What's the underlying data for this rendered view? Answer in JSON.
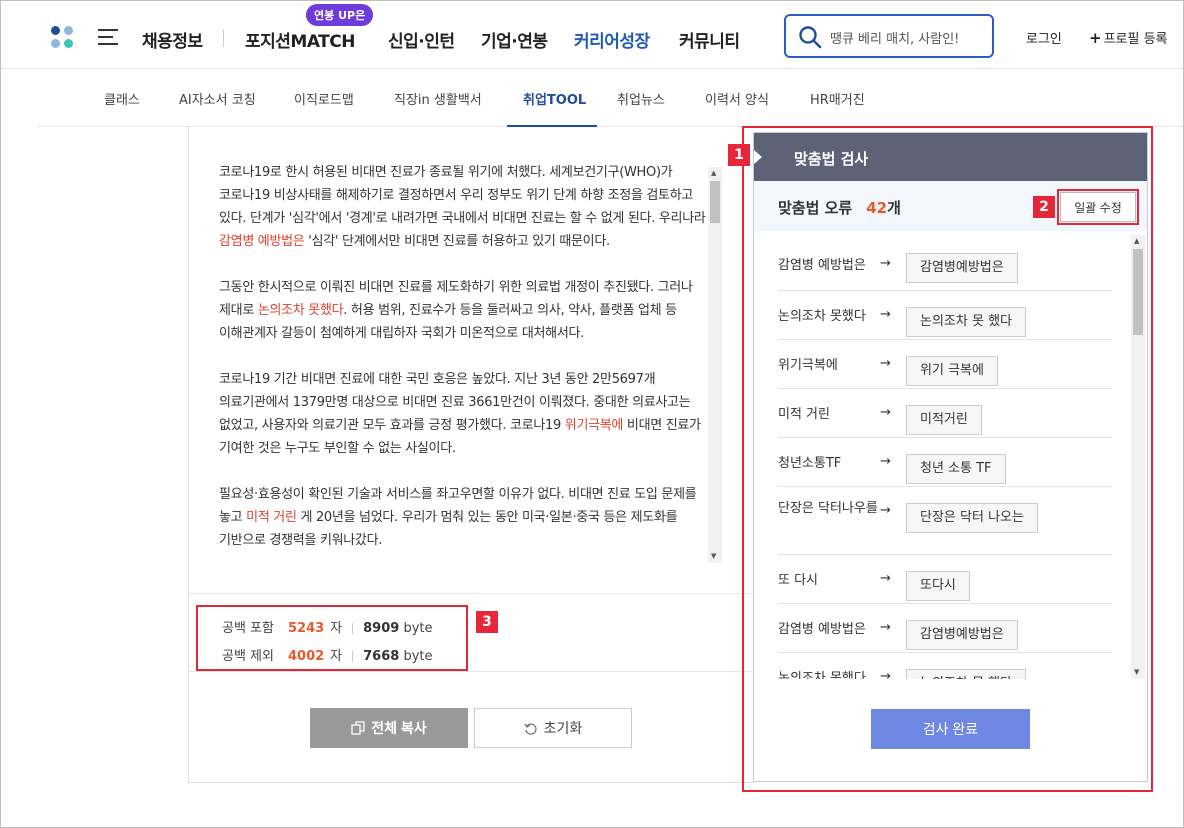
{
  "header": {
    "menu": [
      "채용정보",
      "포지션MATCH",
      "신입·인턴",
      "기업·연봉",
      "커리어성장",
      "커뮤니티"
    ],
    "active_menu": "커리어성장",
    "badge": "연봉 UP은",
    "search_placeholder": "땡큐 베리 매치, 사람인!",
    "login": "로그인",
    "profile_register": "프로필 등록",
    "profile_plus": "+"
  },
  "subnav": {
    "items": [
      "클래스",
      "AI자소서 코칭",
      "이직로드맵",
      "직장in 생활백서",
      "취업TOOL",
      "취업뉴스",
      "이력서 양식",
      "HR매거진"
    ],
    "active": "취업TOOL"
  },
  "editor": {
    "paragraphs": [
      [
        {
          "t": "코로나19로 한시 허용된 비대면 진료가 종료될 위기에 처했다. 세계보건기구(WHO)가 코로나19 비상사태를 해제하기로 결정하면서 우리 정부도 위기 단계 하향 조정을 검토하고 있다. 단계가 '심각'에서 '경계'로 내려가면 국내에서 비대면 진료는 할 수 없게 된다. 우리나라 "
        },
        {
          "t": "감염병 예방법은",
          "hl": true
        },
        {
          "t": " '심각' 단계에서만 비대면 진료를 허용하고 있기 때문이다."
        }
      ],
      [
        {
          "t": "그동안 한시적으로 이뤄진 비대면 진료를 제도화하기 위한 의료법 개정이 추진됐다. 그러나 제대로 "
        },
        {
          "t": "논의조차 못했다",
          "hl": true
        },
        {
          "t": ". 허용 범위, 진료수가 등을 둘러싸고 의사, 약사, 플랫폼 업체 등 이해관계자 갈등이 첨예하게 대립하자 국회가 미온적으로 대처해서다."
        }
      ],
      [
        {
          "t": "코로나19 기간 비대면 진료에 대한 국민 호응은 높았다. 지난 3년 동안 2만5697개 의료기관에서 1379만명 대상으로 비대면 진료 3661만건이 이뤄졌다. 중대한 의료사고는 없었고, 사용자와 의료기관 모두 효과를 긍정 평가했다. 코로나19 "
        },
        {
          "t": "위기극복에",
          "hl": true
        },
        {
          "t": " 비대면 진료가 기여한 것은 누구도 부인할 수 없는 사실이다."
        }
      ],
      [
        {
          "t": "필요성·효용성이 확인된 기술과 서비스를 좌고우면할 이유가 없다. 비대면 진료 도입 문제를 놓고 "
        },
        {
          "t": "미적 거린",
          "hl": true
        },
        {
          "t": " 게 20년을 넘었다. 우리가 멈춰 있는 동안 미국·일본·중국 등은 제도화를 기반으로 경쟁력을 키워나갔다."
        }
      ]
    ],
    "counts": {
      "with_space": {
        "label": "공백 포함",
        "chars": "5243",
        "char_unit": "자",
        "bytes": "8909",
        "byte_unit": "byte"
      },
      "without_space": {
        "label": "공백 제외",
        "chars": "4002",
        "char_unit": "자",
        "bytes": "7668",
        "byte_unit": "byte"
      }
    },
    "copy_all": "전체 복사",
    "reset": "초기화"
  },
  "check": {
    "title": "맞춤법 검사",
    "error_label": "맞춤법 오류",
    "error_count": "42",
    "error_unit": "개",
    "fix_all": "일괄 수정",
    "items": [
      {
        "wrong": "감염병 예방법은",
        "right": "감염병예방법은"
      },
      {
        "wrong": "논의조차 못했다",
        "right": "논의조차 못 했다"
      },
      {
        "wrong": "위기극복에",
        "right": "위기 극복에"
      },
      {
        "wrong": "미적 거린",
        "right": "미적거린"
      },
      {
        "wrong": "청년소통TF",
        "right": "청년 소통 TF"
      },
      {
        "wrong": "단장은 닥터나우를",
        "right": "단장은 닥터 나오는"
      },
      {
        "wrong": "또 다시",
        "right": "또다시"
      },
      {
        "wrong": "감염병 예방법은",
        "right": "감염병예방법은"
      },
      {
        "wrong": "논의조차 못했다",
        "right": "논의조차 못 했다"
      }
    ],
    "arrow": "→",
    "done": "검사 완료"
  },
  "markers": [
    "1",
    "2",
    "3"
  ],
  "colors": {
    "accent_blue": "#1f5bb5",
    "highlight_red": "#e0402e",
    "count_orange": "#e85a2d",
    "panel_header": "#5e6277",
    "done_button": "#6e87e2",
    "annotation_red": "#e62639"
  }
}
